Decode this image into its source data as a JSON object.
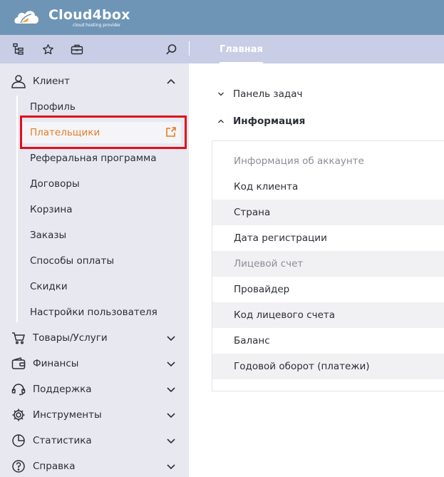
{
  "brand": {
    "name": "Cloud4box",
    "tagline": "cloud hosting provider"
  },
  "toolbar": {
    "icons": [
      "tree-icon",
      "star-icon",
      "briefcase-icon",
      "search-icon"
    ],
    "tab_main": "Главная"
  },
  "sidebar": {
    "client": {
      "label": "Клиент",
      "expanded": true,
      "items": [
        {
          "label": "Профиль"
        },
        {
          "label": "Плательщики",
          "active": true
        },
        {
          "label": "Реферальная программа"
        },
        {
          "label": "Договоры"
        },
        {
          "label": "Корзина"
        },
        {
          "label": "Заказы"
        },
        {
          "label": "Способы оплаты"
        },
        {
          "label": "Скидки"
        },
        {
          "label": "Настройки пользователя"
        }
      ]
    },
    "sections": [
      {
        "label": "Товары/Услуги",
        "icon": "cart-icon"
      },
      {
        "label": "Финансы",
        "icon": "wallet-icon"
      },
      {
        "label": "Поддержка",
        "icon": "headset-icon"
      },
      {
        "label": "Инструменты",
        "icon": "gear-icon"
      },
      {
        "label": "Статистика",
        "icon": "chart-icon"
      },
      {
        "label": "Справка",
        "icon": "help-icon"
      }
    ]
  },
  "main": {
    "panel_tasks": {
      "label": "Панель задач",
      "expanded": false
    },
    "info": {
      "label": "Информация",
      "expanded": true,
      "rows": [
        {
          "label": "Информация об аккаунте"
        },
        {
          "label": "Код клиента"
        },
        {
          "label": "Страна"
        },
        {
          "label": "Дата регистрации"
        },
        {
          "label": "Лицевой счет"
        },
        {
          "label": "Провайдер"
        },
        {
          "label": "Код лицевого счета"
        },
        {
          "label": "Баланс"
        },
        {
          "label": "Годовой оборот (платежи)"
        }
      ]
    }
  },
  "colors": {
    "topbar": "#6e95b6",
    "toolbar": "#c9cde6",
    "sidebar": "#e7e8f0",
    "active_text": "#e57d25",
    "highlight": "#e0101c",
    "logo_accent": "#f0a035"
  }
}
